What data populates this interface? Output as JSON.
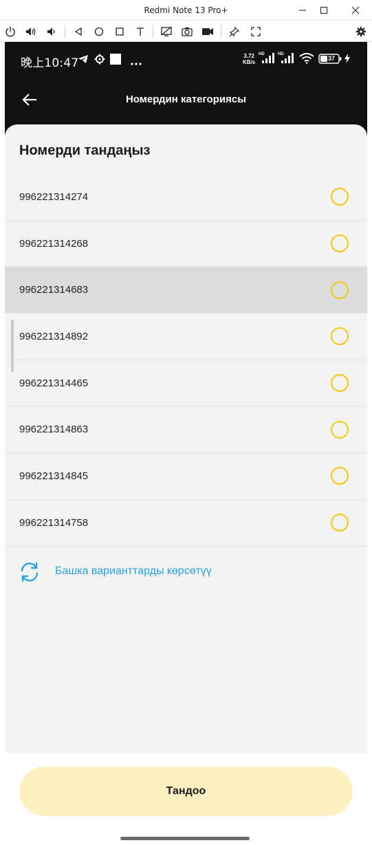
{
  "window": {
    "title": "Redmi Note 13 Pro+",
    "controls": [
      "minimize-icon",
      "maximize-icon",
      "close-icon"
    ]
  },
  "toolbar": {
    "icons": [
      "power-icon",
      "volume-up-icon",
      "volume-down-icon",
      "back-triangle-icon",
      "home-circle-icon",
      "recents-square-icon",
      "text-icon",
      "screen-off-icon",
      "camera-icon",
      "record-icon",
      "pin-icon",
      "fullscreen-icon",
      "settings-icon"
    ]
  },
  "statusbar": {
    "time": "晚上10:47",
    "net_speed_value": "3.72",
    "net_speed_unit": "KB/s",
    "hd1": "HD",
    "hd2": "HD",
    "battery": "37",
    "icons": [
      "telegram-icon",
      "gear-icon",
      "square-icon",
      "more-dots-icon",
      "signal-icon",
      "wifi-icon",
      "battery-icon",
      "charging-icon"
    ]
  },
  "appbar": {
    "title": "Номердин категориясы"
  },
  "sheet": {
    "title": "Номерди тандаңыз",
    "numbers": [
      {
        "number": "996221314274",
        "selected": false
      },
      {
        "number": "996221314268",
        "selected": false
      },
      {
        "number": "996221314683",
        "selected": false,
        "highlighted": true
      },
      {
        "number": "996221314892",
        "selected": false
      },
      {
        "number": "996221314465",
        "selected": false
      },
      {
        "number": "996221314863",
        "selected": false
      },
      {
        "number": "996221314845",
        "selected": false
      },
      {
        "number": "996221314758",
        "selected": false
      }
    ],
    "more_label": "Башка варианттарды көрсөтүү"
  },
  "cta": {
    "label": "Тандоо"
  },
  "colors": {
    "accent_yellow": "#f3c80f",
    "link_blue": "#2aa0dc",
    "cta_bg": "#fdf0c2",
    "header_bg": "#111111",
    "sheet_bg": "#f3f3f3"
  }
}
